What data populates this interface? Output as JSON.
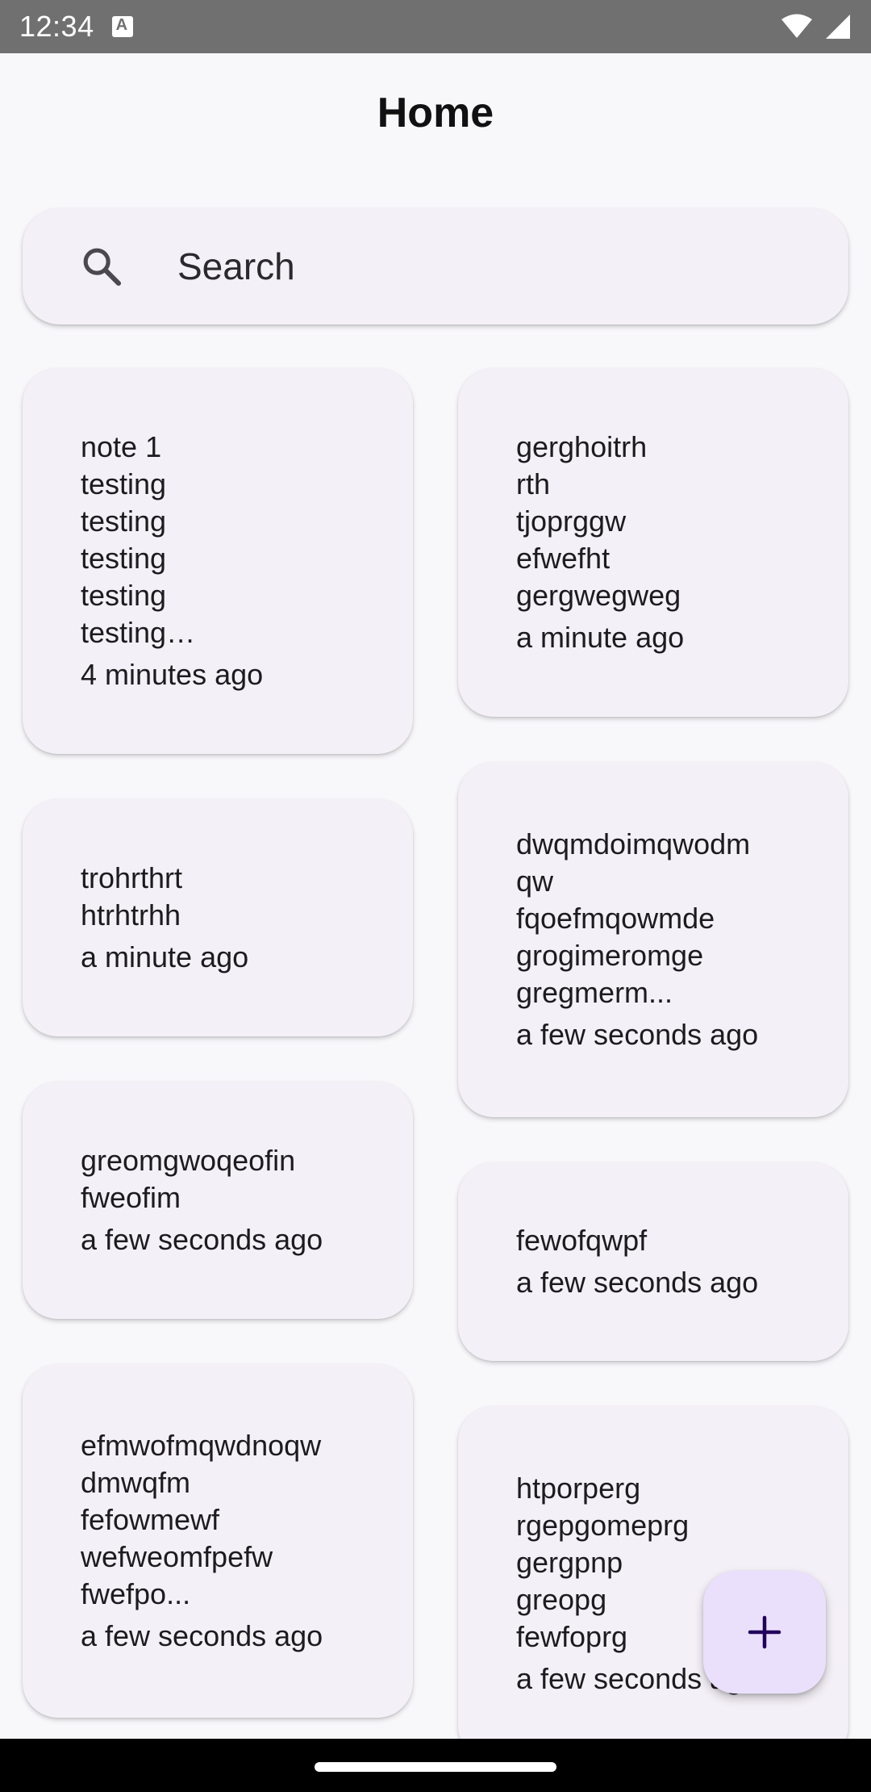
{
  "status_bar": {
    "time": "12:34",
    "icons": [
      "notification-a-icon",
      "wifi-icon",
      "signal-icon"
    ]
  },
  "header": {
    "title": "Home"
  },
  "search": {
    "placeholder": "Search",
    "icon": "search-icon"
  },
  "notes": [
    {
      "text": "note 1\ntesting\ntesting\ntesting\ntesting\ntesting…",
      "time": "4 minutes ago"
    },
    {
      "text": "gerghoitrh\nrth\ntjoprggw\nefwefht\ngergwegweg",
      "time": "a minute ago"
    },
    {
      "text": "trohrthrt\nhtrhtrhh",
      "time": "a minute ago"
    },
    {
      "text": "dwqmdoimqwodm\nqw\nfqoefmqowmde\ngrogimeromge\ngregmerm...",
      "time": "a few seconds ago"
    },
    {
      "text": "greomgwoqeofin\nfweofim",
      "time": "a few seconds ago"
    },
    {
      "text": "fewofqwpf",
      "time": "a few seconds ago"
    },
    {
      "text": "efmwofmqwdnoqw\ndmwqfm\nfefowmewf\nwefweomfpefw\nfwefpo...",
      "time": "a few seconds ago"
    },
    {
      "text": "htporperg\nrgepgomeprg\ngergpnp\ngreopg\nfewfoprg",
      "time": "a few seconds ago"
    }
  ],
  "fab": {
    "icon": "plus-icon"
  },
  "colors": {
    "background": "#f8f7fa",
    "card": "#f4f0f7",
    "fab": "#ebe0fb",
    "fab_icon": "#21005d"
  }
}
